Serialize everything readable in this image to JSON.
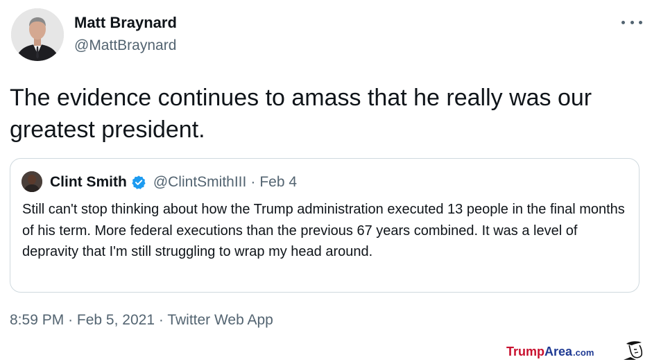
{
  "author": {
    "name": "Matt Braynard",
    "handle": "@MattBraynard"
  },
  "tweet": {
    "text": "The evidence continues to amass that he really was our greatest president."
  },
  "quoted_tweet": {
    "name": "Clint Smith",
    "handle": "@ClintSmithIII",
    "separator": "·",
    "date": "Feb 4",
    "text": "Still can't stop thinking about how the Trump administration executed 13 people in the final months of his term. More federal executions than the previous 67 years combined. It was a level of depravity that I'm still struggling to wrap my head around."
  },
  "footer": {
    "time": "8:59 PM",
    "separator": "·",
    "date": "Feb 5, 2021",
    "source": "Twitter Web App"
  },
  "watermark": {
    "part1": "Trump",
    "part2": "Area",
    "part3": ".com"
  },
  "icons": {
    "more": "more-options-icon",
    "verified": "verified-badge-icon"
  },
  "colors": {
    "text": "#0f1419",
    "secondary": "#536471",
    "border": "#cfd9de",
    "verified": "#1d9bf0",
    "watermark_red": "#c8102e",
    "watermark_blue": "#1f3a93"
  }
}
